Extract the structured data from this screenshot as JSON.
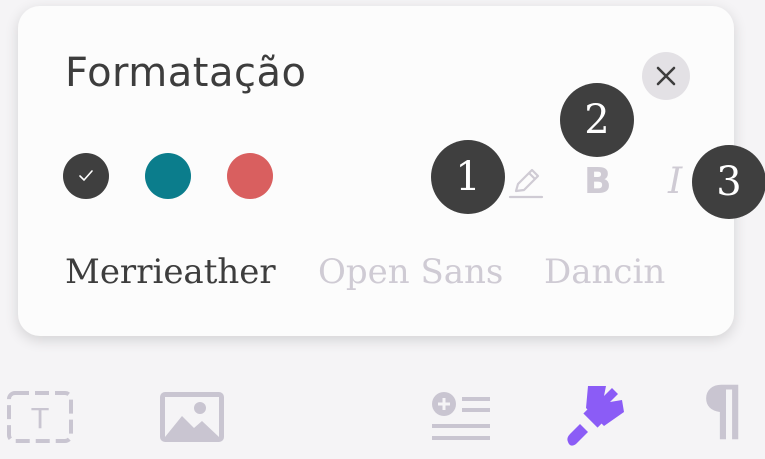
{
  "panel": {
    "title": "Formatação",
    "colors": [
      {
        "name": "dark",
        "hex": "#3f3f3f",
        "selected": true
      },
      {
        "name": "teal",
        "hex": "#0b7d8c",
        "selected": false
      },
      {
        "name": "red",
        "hex": "#d95f5f",
        "selected": false
      }
    ],
    "format_buttons": [
      "pencil-icon",
      "bold-icon",
      "italic-icon"
    ],
    "bold_glyph": "B",
    "italic_glyph": "I",
    "badges": [
      "1",
      "2",
      "3"
    ],
    "fonts": [
      {
        "label": "Merrieather",
        "active": true
      },
      {
        "label": "Open Sans",
        "active": false
      },
      {
        "label": "Dancin",
        "active": false
      }
    ]
  },
  "toolbar": {
    "text_icon_glyph": "T",
    "icons": [
      "text-box-icon",
      "image-icon",
      "add-list-icon",
      "paint-brush-icon",
      "paragraph-icon"
    ],
    "paragraph_glyph": "¶",
    "active_color": "#8b5cf6",
    "inactive_color": "#c9c5d1"
  }
}
